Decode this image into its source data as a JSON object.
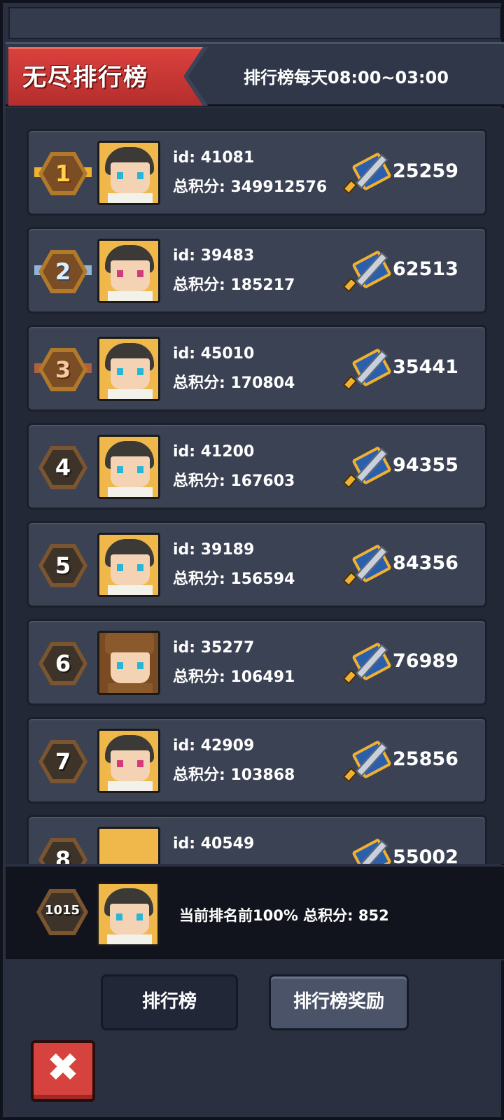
{
  "header": {
    "title": "无尽排行榜",
    "schedule": "排行榜每天08:00~03:00"
  },
  "entries": [
    {
      "rank": "1",
      "id": "id: 41081",
      "score": "总积分: 349912576",
      "power": "25259"
    },
    {
      "rank": "2",
      "id": "id: 39483",
      "score": "总积分: 185217",
      "power": "62513"
    },
    {
      "rank": "3",
      "id": "id: 45010",
      "score": "总积分: 170804",
      "power": "35441"
    },
    {
      "rank": "4",
      "id": "id: 41200",
      "score": "总积分: 167603",
      "power": "94355"
    },
    {
      "rank": "5",
      "id": "id: 39189",
      "score": "总积分: 156594",
      "power": "84356"
    },
    {
      "rank": "6",
      "id": "id: 35277",
      "score": "总积分: 106491",
      "power": "76989"
    },
    {
      "rank": "7",
      "id": "id: 42909",
      "score": "总积分: 103868",
      "power": "25856"
    },
    {
      "rank": "8",
      "id": "id: 40549",
      "score": "",
      "power": "55002"
    }
  ],
  "me": {
    "rank": "1015",
    "summary": "当前排名前100% 总积分: 852"
  },
  "buttons": {
    "rank_tab": "排行榜",
    "reward_tab": "排行榜奖励"
  },
  "icons": {
    "power": "sword-shield-icon",
    "close": "close-icon"
  }
}
